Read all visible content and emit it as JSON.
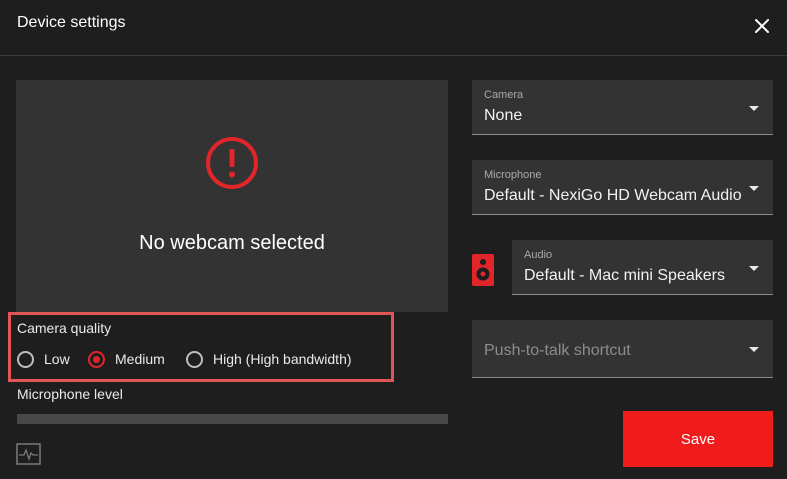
{
  "dialog": {
    "title": "Device settings"
  },
  "preview": {
    "message": "No webcam selected"
  },
  "quality": {
    "label": "Camera quality",
    "options": [
      "Low",
      "Medium",
      "High (High bandwidth)"
    ],
    "selected": "Medium"
  },
  "microphone_level": {
    "label": "Microphone level",
    "level": 0
  },
  "camera": {
    "label": "Camera",
    "value": "None"
  },
  "microphone": {
    "label": "Microphone",
    "value": "Default - NexiGo HD Webcam Audio"
  },
  "audio": {
    "label": "Audio",
    "value": "Default - Mac mini Speakers"
  },
  "push_to_talk": {
    "placeholder": "Push-to-talk shortcut"
  },
  "buttons": {
    "save": "Save"
  },
  "colors": {
    "accent": "#f01b1b",
    "highlight": "#e05555",
    "panel": "#333333",
    "background": "#1e1e1e"
  },
  "icons": [
    "close-icon",
    "warning-icon",
    "speaker-icon",
    "pulse-icon",
    "chevron-down-icon"
  ]
}
